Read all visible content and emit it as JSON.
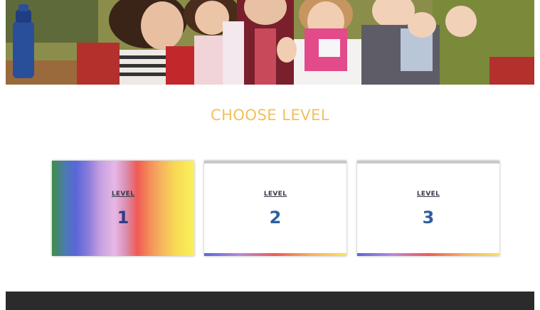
{
  "heading": "CHOOSE LEVEL",
  "colors": {
    "heading": "#f2c05a",
    "level_number": "#2f5f9e",
    "footer": "#2b2b2b"
  },
  "levels": [
    {
      "label": "LEVEL",
      "number": "1",
      "selected": true
    },
    {
      "label": "LEVEL",
      "number": "2",
      "selected": false
    },
    {
      "label": "LEVEL",
      "number": "3",
      "selected": false
    }
  ]
}
